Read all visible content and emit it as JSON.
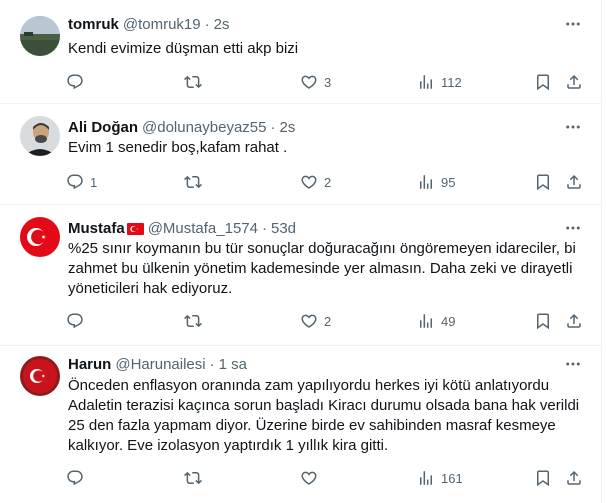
{
  "tweets": [
    {
      "name": "tomruk",
      "handle": "@tomruk19",
      "time": "2s",
      "text": "Kendi evimize düşman etti akp bizi",
      "replies": "",
      "retweets": "",
      "likes": "3",
      "views": "112"
    },
    {
      "name": "Ali Doğan",
      "handle": "@dolunaybeyaz55",
      "time": "2s",
      "text": "Evim 1 senedir boş,kafam rahat .",
      "replies": "1",
      "retweets": "",
      "likes": "2",
      "views": "95"
    },
    {
      "name": "Mustafa",
      "handle": "@Mustafa_1574",
      "time": "53d",
      "text": "%25 sınır koymanın bu tür sonuçlar doğuracağını öngöremeyen idareciler, bi zahmet bu ülkenin yönetim kademesinde yer almasın. Daha zeki ve dirayetli yöneticileri hak ediyoruz.",
      "replies": "",
      "retweets": "",
      "likes": "2",
      "views": "49"
    },
    {
      "name": "Harun",
      "handle": "@Harunailesi",
      "time": "1 sa",
      "text": "Önceden enflasyon oranında zam yapılıyordu herkes iyi kötü anlatıyordu Adaletin terazisi kaçınca sorun başladı Kiracı durumu olsada bana hak verildi 25 den fazla yapmam diyor. Üzerine birde ev sahibinden masraf kesmeye kalkıyor. Eve izolasyon yaptırdık 1 yıllık kira gitti.",
      "replies": "",
      "retweets": "",
      "likes": "",
      "views": "161"
    }
  ],
  "colors": {
    "text": "#0f1419",
    "muted": "#536471",
    "divider": "#eff3f4",
    "flag_red": "#e30a17"
  },
  "icons": [
    "more-icon",
    "reply-icon",
    "retweet-icon",
    "like-icon",
    "views-icon",
    "bookmark-icon",
    "share-icon",
    "turkish-flag-icon"
  ]
}
